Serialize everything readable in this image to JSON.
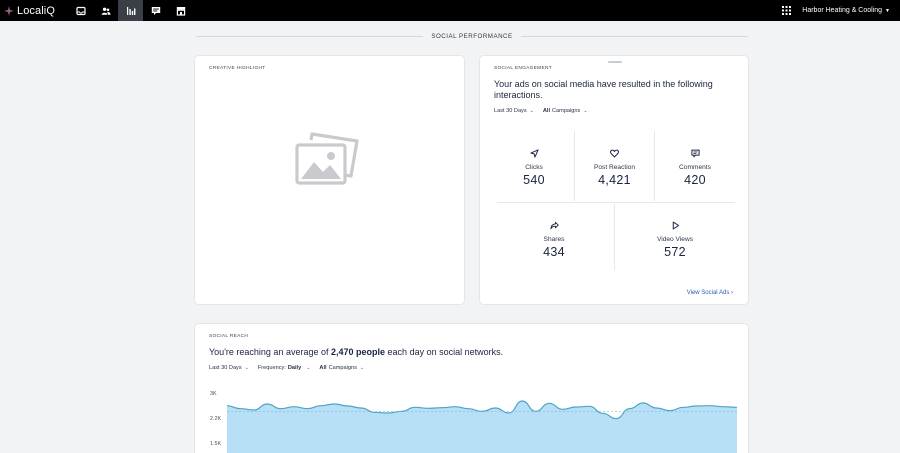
{
  "app": {
    "brand": "LocaliQ",
    "account_name": "Harbor Heating & Cooling"
  },
  "nav": [
    {
      "icon": "inbox-icon",
      "active": false
    },
    {
      "icon": "users-icon",
      "active": false
    },
    {
      "icon": "bar-chart-icon",
      "active": true
    },
    {
      "icon": "message-icon",
      "active": false
    },
    {
      "icon": "store-icon",
      "active": false
    }
  ],
  "section_title": "SOCIAL PERFORMANCE",
  "creative": {
    "label": "CREATIVE HIGHLIGHT",
    "image_icon": "image-placeholder-icon"
  },
  "engagement": {
    "label": "SOCIAL ENGAGEMENT",
    "heading": "Your ads on social media have resulted in the following interactions.",
    "filters": {
      "range": "Last 30 Days",
      "campaign_prefix": "All",
      "campaign_rest": "Campaigns"
    },
    "metrics": [
      {
        "label": "Clicks",
        "value": "540",
        "icon": "send-icon"
      },
      {
        "label": "Post Reaction",
        "value": "4,421",
        "icon": "heart-icon"
      },
      {
        "label": "Comments",
        "value": "420",
        "icon": "comment-icon"
      },
      {
        "label": "Shares",
        "value": "434",
        "icon": "share-icon"
      },
      {
        "label": "Video Views",
        "value": "572",
        "icon": "play-icon"
      }
    ],
    "view_link": "View Social Ads"
  },
  "reach": {
    "label": "SOCIAL REACH",
    "heading_prefix": "You're reaching an average of",
    "heading_value": "2,470 people",
    "heading_suffix": "each day on social networks.",
    "filters": {
      "range": "Last 30 Days",
      "frequency_label": "Frequency:",
      "frequency_value": "Daily",
      "campaign_prefix": "All",
      "campaign_rest": "Campaigns"
    },
    "colors": {
      "fill": "#b7e0f7",
      "line": "#4fa3c7"
    }
  },
  "chart_data": {
    "type": "area",
    "title": "",
    "xlabel": "",
    "ylabel": "",
    "y_ticks": [
      "3K",
      "2.2K",
      "1.5K"
    ],
    "ylim": [
      1500,
      3000
    ],
    "series": [
      {
        "values": [
          2650,
          2560,
          2520,
          2700,
          2560,
          2620,
          2560,
          2650,
          2700,
          2640,
          2580,
          2450,
          2430,
          2480,
          2600,
          2570,
          2590,
          2620,
          2560,
          2480,
          2580,
          2430,
          2790,
          2480,
          2720,
          2540,
          2610,
          2630,
          2420,
          2260,
          2560,
          2730,
          2580,
          2500,
          2600,
          2640,
          2650,
          2620,
          2600
        ]
      }
    ],
    "average_line": 2470
  }
}
